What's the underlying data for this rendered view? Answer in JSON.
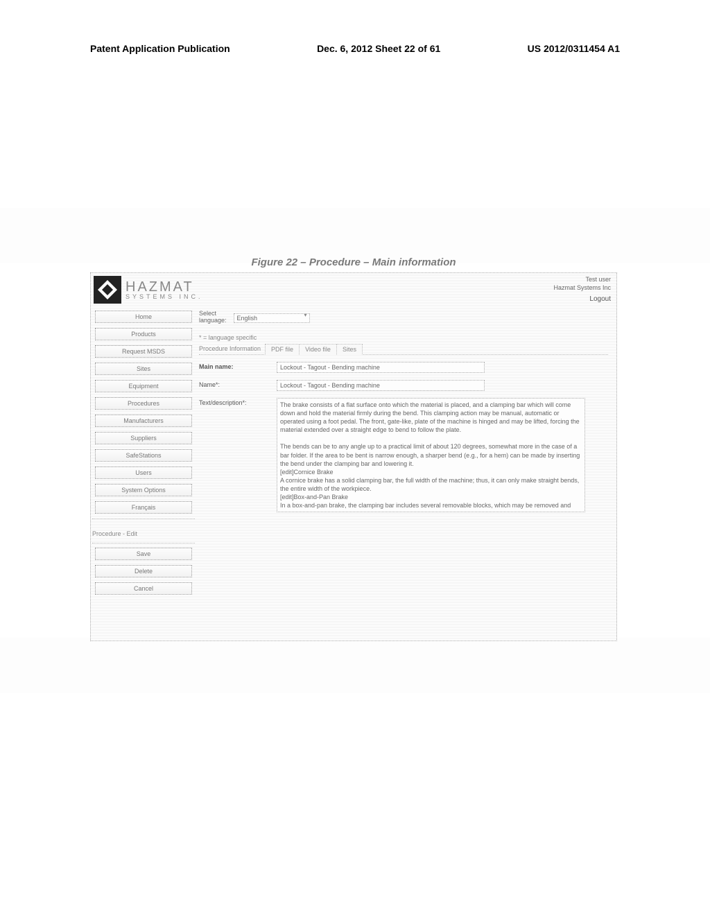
{
  "page_header": {
    "left": "Patent Application Publication",
    "center": "Dec. 6, 2012   Sheet 22 of 61",
    "right": "US 2012/0311454 A1"
  },
  "figure_title": "Figure 22 – Procedure – Main information",
  "logo": {
    "main": "HAZMAT",
    "sub": "SYSTEMS INC."
  },
  "top_right": {
    "user": "Test user",
    "company": "Hazmat Systems Inc",
    "logout": "Logout"
  },
  "sidebar": {
    "items": [
      {
        "label": "Home"
      },
      {
        "label": "Products"
      },
      {
        "label": "Request MSDS"
      },
      {
        "label": "Sites"
      },
      {
        "label": "Equipment"
      },
      {
        "label": "Procedures"
      },
      {
        "label": "Manufacturers"
      },
      {
        "label": "Suppliers"
      },
      {
        "label": "SafeStations"
      },
      {
        "label": "Users"
      },
      {
        "label": "System Options"
      },
      {
        "label": "Français"
      }
    ],
    "section_title": "Procedure - Edit",
    "actions": [
      {
        "label": "Save"
      },
      {
        "label": "Delete"
      },
      {
        "label": "Cancel"
      }
    ]
  },
  "language": {
    "label_line1": "Select",
    "label_line2": "language:",
    "selected": "English",
    "note": "* = language specific"
  },
  "tabs": {
    "preface": "Procedure Information",
    "items": [
      {
        "label": "PDF file",
        "active": false
      },
      {
        "label": "Video file",
        "active": false
      },
      {
        "label": "Sites",
        "active": false
      }
    ]
  },
  "form": {
    "main_name_label": "Main name:",
    "main_name_value": "Lockout - Tagout - Bending machine",
    "name_label": "Name*:",
    "name_value": "Lockout - Tagout - Bending machine",
    "desc_label": "Text/description*:",
    "desc_value": "The brake consists of a flat surface onto which the material is placed, and a clamping bar which will come down and hold the material firmly during the bend. This clamping action may be manual, automatic or operated using a foot pedal. The front, gate-like, plate of the machine is hinged and may be lifted, forcing the material extended over a straight edge to bend to follow the plate.\n\nThe bends can be to any angle up to a practical limit of about 120 degrees, somewhat more in the case of a bar folder. If the area to be bent is narrow enough, a sharper bend (e.g., for a hem) can be made by inserting the bend under the clamping bar and lowering it.\n[edit]Cornice Brake\nA cornice brake has a solid clamping bar, the full width of the machine; thus, it can only make straight bends, the entire width of the workpiece.\n[edit]Box-and-Pan Brake\nIn a box-and-pan brake, the clamping bar includes several removable blocks, which may be removed and rearranged to permit bending of restricted areas of a piece of sheet metal or of already partially formed pieces.\nAfter bending, a box or pan form is then completed by screw, solder, weld, rivet, or other metal fixing process."
  }
}
